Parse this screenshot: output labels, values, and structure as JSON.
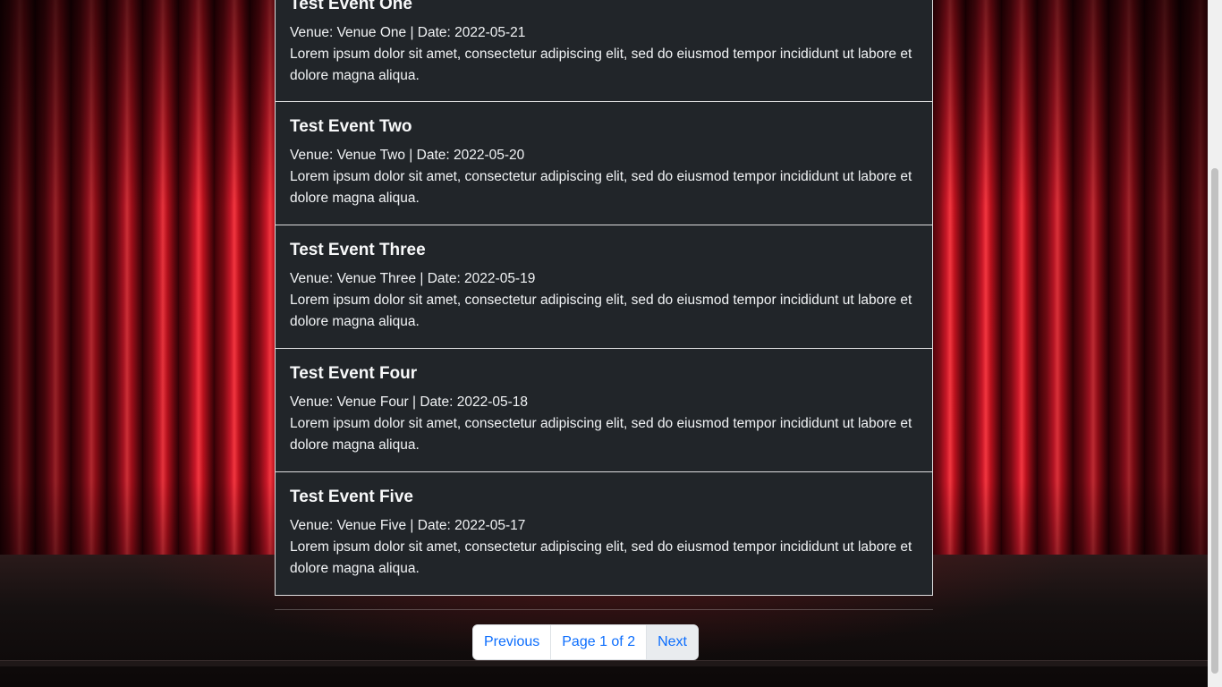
{
  "events": [
    {
      "title": "Test Event One",
      "meta": "Venue: Venue One | Date: 2022-05-21",
      "description": "Lorem ipsum dolor sit amet, consectetur adipiscing elit, sed do eiusmod tempor incididunt ut labore et dolore magna aliqua."
    },
    {
      "title": "Test Event Two",
      "meta": "Venue: Venue Two | Date: 2022-05-20",
      "description": "Lorem ipsum dolor sit amet, consectetur adipiscing elit, sed do eiusmod tempor incididunt ut labore et dolore magna aliqua."
    },
    {
      "title": "Test Event Three",
      "meta": "Venue: Venue Three | Date: 2022-05-19",
      "description": "Lorem ipsum dolor sit amet, consectetur adipiscing elit, sed do eiusmod tempor incididunt ut labore et dolore magna aliqua."
    },
    {
      "title": "Test Event Four",
      "meta": "Venue: Venue Four | Date: 2022-05-18",
      "description": "Lorem ipsum dolor sit amet, consectetur adipiscing elit, sed do eiusmod tempor incididunt ut labore et dolore magna aliqua."
    },
    {
      "title": "Test Event Five",
      "meta": "Venue: Venue Five | Date: 2022-05-17",
      "description": "Lorem ipsum dolor sit amet, consectetur adipiscing elit, sed do eiusmod tempor incididunt ut labore et dolore magna aliqua."
    }
  ],
  "pagination": {
    "previous_label": "Previous",
    "page_label": "Page 1 of 2",
    "next_label": "Next"
  },
  "colors": {
    "card_background": "#212529",
    "link": "#0d6efd",
    "curtain": "#d1182a"
  }
}
